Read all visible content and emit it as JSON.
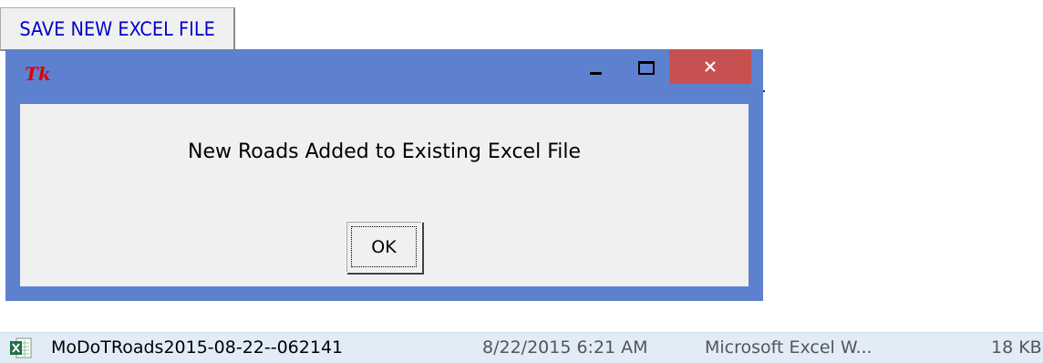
{
  "toolbar": {
    "save_button_label": "SAVE NEW EXCEL FILE"
  },
  "dialog": {
    "title": "",
    "app_icon": "tk-feather-icon",
    "message": "New Roads Added to Existing Excel File",
    "ok_label": "OK",
    "titlebar_buttons": [
      "minimize",
      "maximize",
      "close"
    ],
    "colors": {
      "frame": "#5e81cf",
      "close": "#c75050",
      "body": "#f0f0f0"
    }
  },
  "file_list": {
    "rows": [
      {
        "icon": "excel-file-icon",
        "name": "MoDoTRoads2015-08-22--062141",
        "date_modified": "8/22/2015 6:21 AM",
        "type": "Microsoft Excel W...",
        "size": "18 KB"
      }
    ],
    "selected_color": "#e1ecf7"
  }
}
